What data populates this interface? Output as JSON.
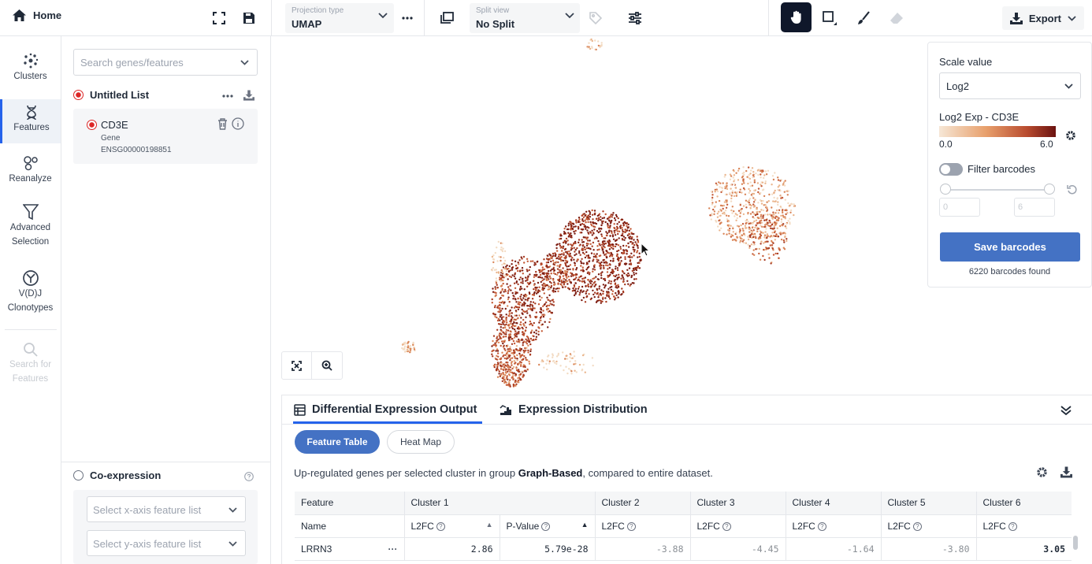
{
  "topbar": {
    "home_label": "Home",
    "projection": {
      "small_label": "Projection type",
      "value": "UMAP"
    },
    "split": {
      "small_label": "Split view",
      "value": "No Split"
    },
    "export_label": "Export"
  },
  "nav": {
    "items": [
      {
        "label": "Clusters",
        "icon": "clusters-icon"
      },
      {
        "label": "Features",
        "icon": "features-icon"
      },
      {
        "label": "Reanalyze",
        "icon": "reanalyze-icon"
      },
      {
        "label": "Advanced Selection",
        "icon": "filter-icon"
      },
      {
        "label": "V(D)J Clonotypes",
        "icon": "clonotype-icon"
      },
      {
        "label": "Search for Features",
        "icon": "search-icon"
      }
    ]
  },
  "panel": {
    "search_placeholder": "Search genes/features",
    "list_title": "Untitled List",
    "feature": {
      "name": "CD3E",
      "type": "Gene",
      "id": "ENSG00000198851"
    },
    "coexpression": {
      "title": "Co-expression",
      "x_placeholder": "Select x-axis feature list",
      "y_placeholder": "Select y-axis feature list"
    }
  },
  "legend": {
    "scale_label": "Scale value",
    "scale_value": "Log2",
    "gradient_title": "Log2 Exp - CD3E",
    "gradient_min": "0.0",
    "gradient_max": "6.0",
    "filter_label": "Filter barcodes",
    "min_input": "0",
    "max_input": "6",
    "save_label": "Save barcodes",
    "found_text": "6220 barcodes found",
    "colors": {
      "low": "#f6e7d6",
      "mid": "#e8a06c",
      "high": "#6b1210"
    }
  },
  "bottom": {
    "tabs": [
      {
        "label": "Differential Expression Output"
      },
      {
        "label": "Expression Distribution"
      }
    ],
    "pills": {
      "feature_table": "Feature Table",
      "heat_map": "Heat Map"
    },
    "desc_pre": "Up-regulated genes per selected cluster in group ",
    "desc_group": "Graph-Based",
    "desc_post": ", compared to entire dataset.",
    "table": {
      "feature_header": "Feature",
      "name_header": "Name",
      "clusters": [
        "Cluster 1",
        "Cluster 2",
        "Cluster 3",
        "Cluster 4",
        "Cluster 5",
        "Cluster 6"
      ],
      "l2fc_label": "L2FC",
      "pvalue_label": "P-Value",
      "rows": [
        {
          "name": "LRRN3",
          "c1_l2fc": "2.86",
          "c1_p": "5.79e-28",
          "c2": "-3.88",
          "c3": "-4.45",
          "c4": "-1.64",
          "c5": "-3.80",
          "c6": "3.05"
        }
      ]
    }
  }
}
